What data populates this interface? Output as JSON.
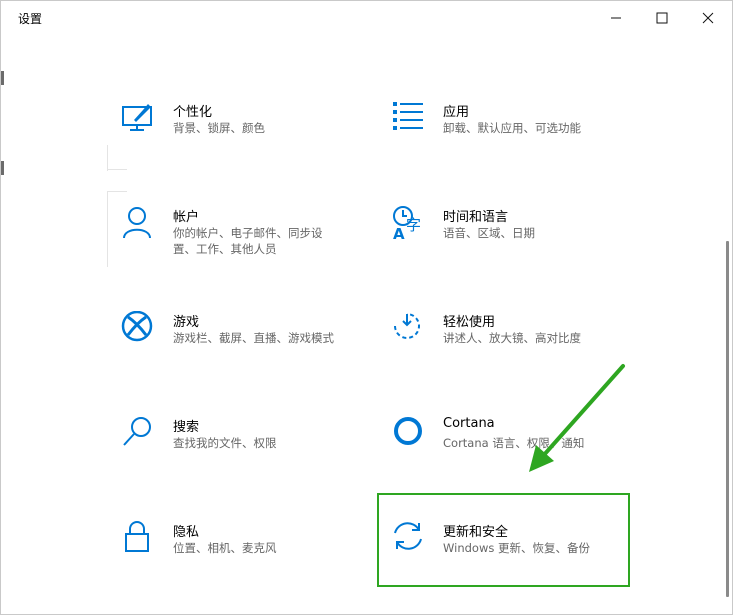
{
  "window": {
    "title": "设置",
    "controls": {
      "minimize_glyph": "—",
      "maximize_glyph": "☐",
      "close_glyph": "✕"
    }
  },
  "settings": {
    "personalization": {
      "label": "个性化",
      "desc": "背景、锁屏、颜色",
      "icon": "personalization-icon"
    },
    "apps": {
      "label": "应用",
      "desc": "卸载、默认应用、可选功能",
      "icon": "apps-icon"
    },
    "accounts": {
      "label": "帐户",
      "desc": "你的帐户、电子邮件、同步设置、工作、其他人员",
      "icon": "accounts-icon"
    },
    "time_language": {
      "label": "时间和语言",
      "desc": "语音、区域、日期",
      "icon": "time-language-icon"
    },
    "gaming": {
      "label": "游戏",
      "desc": "游戏栏、截屏、直播、游戏模式",
      "icon": "xbox-icon"
    },
    "ease_of_access": {
      "label": "轻松使用",
      "desc": "讲述人、放大镜、高对比度",
      "icon": "ease-of-access-icon"
    },
    "search": {
      "label": "搜索",
      "desc": "查找我的文件、权限",
      "icon": "search-icon"
    },
    "cortana": {
      "label": "Cortana",
      "desc": "Cortana 语言、权限、通知",
      "icon": "cortana-icon"
    },
    "privacy": {
      "label": "隐私",
      "desc": "位置、相机、麦克风",
      "icon": "lock-icon"
    },
    "update_security": {
      "label": "更新和安全",
      "desc": "Windows 更新、恢复、备份",
      "icon": "update-icon"
    }
  },
  "colors": {
    "accent": "#0078d4",
    "highlight": "#2ea621"
  }
}
